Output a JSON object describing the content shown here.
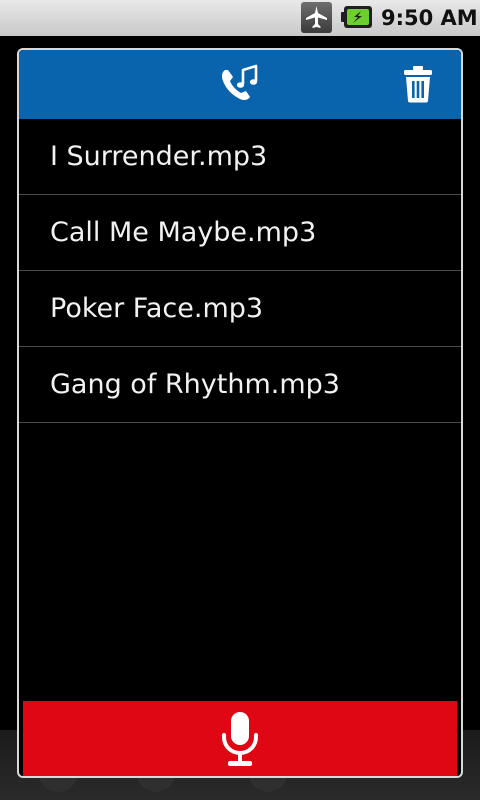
{
  "status_bar": {
    "time": "9:50 AM",
    "icons": [
      "airplane-mode-icon",
      "battery-charging-icon"
    ]
  },
  "dialog": {
    "header": {
      "color": "#0a63ad",
      "buttons": [
        "ringtone-icon",
        "delete-icon"
      ]
    },
    "files": [
      {
        "name": "I Surrender.mp3"
      },
      {
        "name": "Call Me Maybe.mp3"
      },
      {
        "name": "Poker Face.mp3"
      },
      {
        "name": "Gang of Rhythm.mp3"
      }
    ],
    "record_button": {
      "color": "#e00714",
      "icon": "microphone-icon"
    }
  }
}
